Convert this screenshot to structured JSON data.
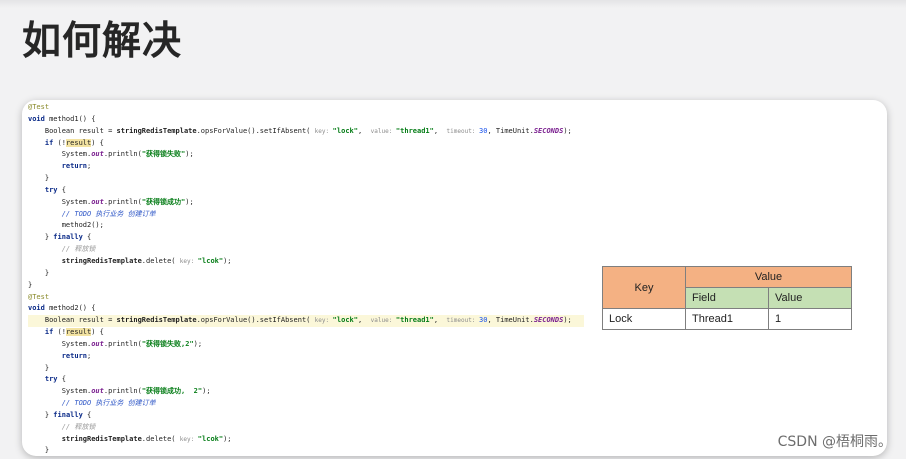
{
  "page": {
    "title": "如何解决"
  },
  "code_lines": [
    [
      [
        "ann",
        "@Test"
      ]
    ],
    [
      [
        "kw",
        "void "
      ],
      [
        "txt",
        "method1() {"
      ]
    ],
    [
      [
        "txt",
        "    Boolean result = "
      ],
      [
        "fn",
        "stringRedisTemplate"
      ],
      [
        "txt",
        ".opsForValue().setIfAbsent( "
      ],
      [
        "hint",
        "key: "
      ],
      [
        "str",
        "\"lock\""
      ],
      [
        "txt",
        ",  "
      ],
      [
        "hint",
        "value: "
      ],
      [
        "str",
        "\"thread1\""
      ],
      [
        "txt",
        ",  "
      ],
      [
        "hint",
        "timeout: "
      ],
      [
        "num",
        "30"
      ],
      [
        "txt",
        ", TimeUnit."
      ],
      [
        "fld",
        "SECONDS"
      ],
      [
        "txt",
        ");"
      ]
    ],
    [
      [
        "kw",
        "    if "
      ],
      [
        "txt",
        "(!"
      ],
      [
        "var",
        "result"
      ],
      [
        "txt",
        ") {"
      ]
    ],
    [
      [
        "txt",
        "        System."
      ],
      [
        "fld",
        "out"
      ],
      [
        "txt",
        ".println("
      ],
      [
        "str",
        "\"获得锁失败\""
      ],
      [
        "txt",
        ");"
      ]
    ],
    [
      [
        "kw",
        "        return"
      ],
      [
        "txt",
        ";"
      ]
    ],
    [
      [
        "txt",
        "    }"
      ]
    ],
    [
      [
        "kw",
        "    try "
      ],
      [
        "txt",
        "{"
      ]
    ],
    [
      [
        "txt",
        "        System."
      ],
      [
        "fld",
        "out"
      ],
      [
        "txt",
        ".println("
      ],
      [
        "str",
        "\"获得锁成功\""
      ],
      [
        "txt",
        ");"
      ]
    ],
    [
      [
        "cmt",
        "        // TODO 执行业务 创建订单"
      ]
    ],
    [
      [
        "txt",
        "        method2();"
      ]
    ],
    [
      [
        "txt",
        "    } "
      ],
      [
        "kw",
        "finally "
      ],
      [
        "txt",
        "{"
      ]
    ],
    [
      [
        "cmt-gray",
        "        // 释放锁"
      ]
    ],
    [
      [
        "fn",
        "        stringRedisTemplate"
      ],
      [
        "txt",
        ".delete( "
      ],
      [
        "hint",
        "key: "
      ],
      [
        "str",
        "\"lcok\""
      ],
      [
        "txt",
        ");"
      ]
    ],
    [
      [
        "txt",
        "    }"
      ]
    ],
    [
      [
        "txt",
        "}"
      ]
    ],
    [
      [
        "ann",
        "@Test"
      ]
    ],
    [
      [
        "kw",
        "void "
      ],
      [
        "txt",
        "method2() {"
      ]
    ],
    [
      [
        "txt",
        "    Boolean result = "
      ],
      [
        "fn",
        "stringRedisTemplate"
      ],
      [
        "txt",
        ".opsForValue().setIfAbsent( "
      ],
      [
        "hint",
        "key: "
      ],
      [
        "str",
        "\"lock\""
      ],
      [
        "txt",
        ",  "
      ],
      [
        "hint",
        "value: "
      ],
      [
        "str",
        "\"thread1\""
      ],
      [
        "txt",
        ",  "
      ],
      [
        "hint",
        "timeout: "
      ],
      [
        "num",
        "30"
      ],
      [
        "txt",
        ", TimeUnit."
      ],
      [
        "fld",
        "SECONDS"
      ],
      [
        "txt",
        ");"
      ]
    ],
    [
      [
        "kw",
        "    if "
      ],
      [
        "txt",
        "(!"
      ],
      [
        "var",
        "result"
      ],
      [
        "txt",
        ") {"
      ]
    ],
    [
      [
        "txt",
        "        System."
      ],
      [
        "fld",
        "out"
      ],
      [
        "txt",
        ".println("
      ],
      [
        "str",
        "\"获得锁失败,2\""
      ],
      [
        "txt",
        ");"
      ]
    ],
    [
      [
        "kw",
        "        return"
      ],
      [
        "txt",
        ";"
      ]
    ],
    [
      [
        "txt",
        "    }"
      ]
    ],
    [
      [
        "kw",
        "    try "
      ],
      [
        "txt",
        "{"
      ]
    ],
    [
      [
        "txt",
        "        System."
      ],
      [
        "fld",
        "out"
      ],
      [
        "txt",
        ".println("
      ],
      [
        "str",
        "\"获得锁成功,  2\""
      ],
      [
        "txt",
        ");"
      ]
    ],
    [
      [
        "cmt",
        "        // TODO 执行业务 创建订单"
      ]
    ],
    [
      [
        "txt",
        "    } "
      ],
      [
        "kw",
        "finally "
      ],
      [
        "txt",
        "{"
      ]
    ],
    [
      [
        "cmt-gray",
        "        // 释放锁"
      ]
    ],
    [
      [
        "fn",
        "        stringRedisTemplate"
      ],
      [
        "txt",
        ".delete( "
      ],
      [
        "hint",
        "key: "
      ],
      [
        "str",
        "\"lcok\""
      ],
      [
        "txt",
        ");"
      ]
    ],
    [
      [
        "txt",
        "    }"
      ]
    ]
  ],
  "highlighted_line_index": 18,
  "kv_table": {
    "key_header": "Key",
    "value_header": "Value",
    "field_header": "Field",
    "value_sub_header": "Value",
    "row": {
      "key": "Lock",
      "field": "Thread1",
      "value": "1"
    }
  },
  "watermark": "CSDN @梧桐雨。",
  "colors": {
    "key_header_bg": "#f4b183",
    "sub_header_bg": "#c5e0b4",
    "keyword": "#0a2a88",
    "string": "#067d17"
  }
}
